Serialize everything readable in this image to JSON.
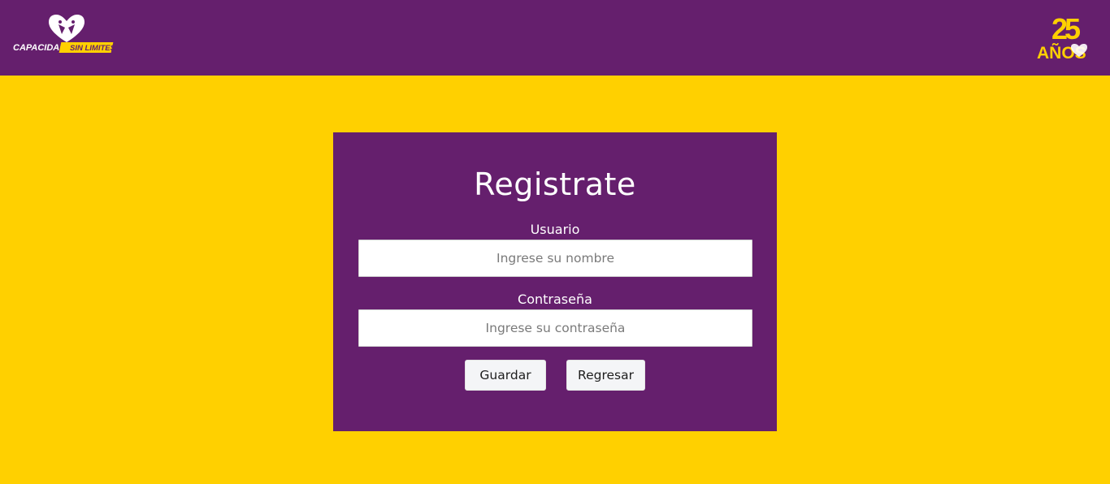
{
  "header": {
    "logo_left": {
      "word1": "CAPACIDAD",
      "word2": "SIN LIMITES"
    },
    "logo_right": {
      "number": "25",
      "word": "AÑOS"
    }
  },
  "form": {
    "title": "Registrate",
    "user_label": "Usuario",
    "user_placeholder": "Ingrese su nombre",
    "user_value": "",
    "password_label": "Contraseña",
    "password_placeholder": "Ingrese su contraseña",
    "password_value": "",
    "save_label": "Guardar",
    "back_label": "Regresar"
  },
  "colors": {
    "background": "#FFD000",
    "primary": "#651F6D",
    "button": "#F4F5F7"
  }
}
